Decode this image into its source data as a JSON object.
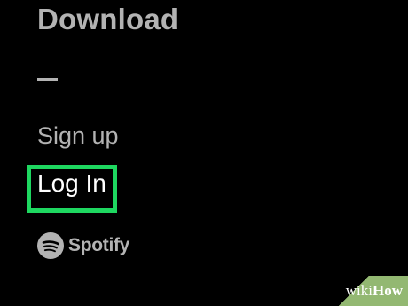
{
  "menu": {
    "download_label": "Download",
    "signup_label": "Sign up",
    "login_label": "Log In",
    "highlight_color": "#1ed760"
  },
  "brand": {
    "logo_icon": "spotify-logo-icon",
    "name": "Spotify"
  },
  "watermark": {
    "wiki": "wiki",
    "how": "How",
    "color": "#93b872"
  }
}
